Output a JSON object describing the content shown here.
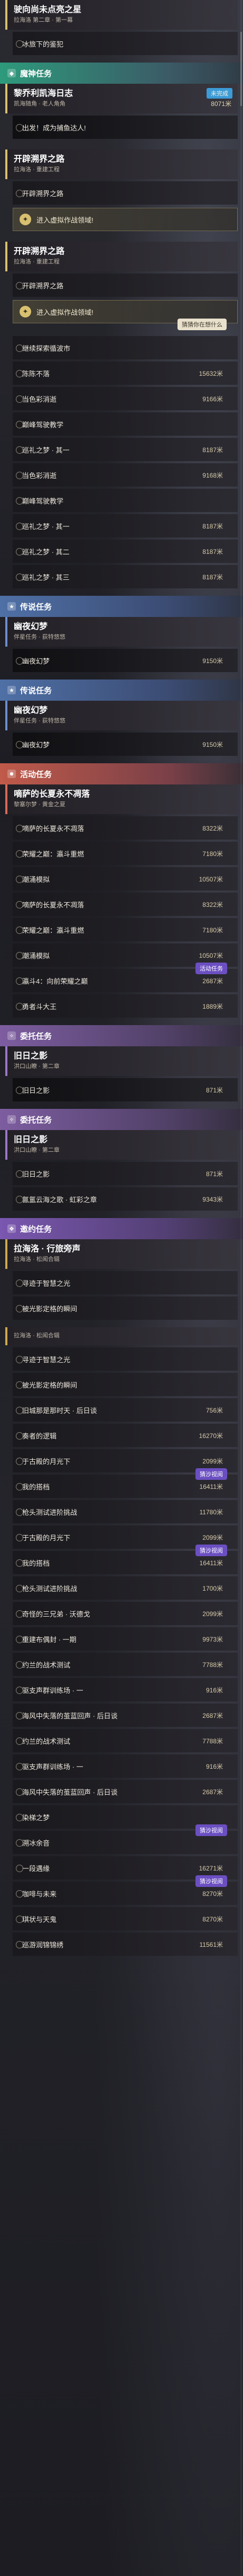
{
  "sections": {
    "main_quest": "魔神任务",
    "side_quest": "传说任务",
    "event_quest": "活动任务",
    "companion_quest": "委托任务",
    "invite_quest": "邀约任务"
  },
  "top": {
    "title": "驶向尚未点亮之星",
    "sub": "拉海洛 第二章 · 第一幕",
    "row1": "冰旅下的鉴犯"
  },
  "main": [
    {
      "title": "黎乔利凯海日志",
      "sub": "凯海随角 · 老人角角",
      "tag": "未完成",
      "points": "8071米",
      "rows": [
        {
          "label": "出发！成为捕鱼达人!",
          "points": ""
        }
      ]
    }
  ],
  "blocks": [
    {
      "title": "开辟溯界之路",
      "sub": "拉海洛 · 重建工程",
      "rows": [
        {
          "label": "开辟溯界之路",
          "points": ""
        }
      ],
      "domain": "进入虚拟作战领域!"
    },
    {
      "title": "开辟溯界之路",
      "sub": "拉海洛 · 重建工程",
      "rows": [
        {
          "label": "开辟溯界之路",
          "points": ""
        }
      ],
      "domain": "进入虚拟作战领域!",
      "badge": "猜猜你在想什么"
    }
  ],
  "list_a": [
    {
      "label": "继续探索循波市",
      "points": ""
    },
    {
      "label": "陈陈不落",
      "points": "15632米"
    },
    {
      "label": "当色彩消逝",
      "points": "9166米"
    },
    {
      "label": "巅峰驾驶教学",
      "points": ""
    },
    {
      "label": "巡礼之梦 · 其一",
      "points": "8187米"
    },
    {
      "label": "当色彩消逝",
      "points": "9168米"
    },
    {
      "label": "巅峰驾驶教学",
      "points": ""
    },
    {
      "label": "巡礼之梦 · 其一",
      "points": "8187米"
    },
    {
      "label": "巡礼之梦 · 其二",
      "points": "8187米"
    },
    {
      "label": "巡礼之梦 · 其三",
      "points": "8187米"
    }
  ],
  "side_a": {
    "title": "幽夜幻梦",
    "sub": "伴星任务 · 荻特悠悠",
    "rows": [
      {
        "label": "幽夜幻梦",
        "points": "9150米"
      }
    ]
  },
  "side_b": {
    "title": "幽夜幻梦",
    "sub": "伴星任务 · 荻特悠悠",
    "rows": [
      {
        "label": "幽夜幻梦",
        "points": "9150米"
      }
    ]
  },
  "event": {
    "title": "嘀萨的长夏永不凋落",
    "sub": "黎塞尔梦 · 黄金之夏",
    "rows": [
      {
        "label": "嘀萨的长夏永不凋落",
        "points": "8322米"
      },
      {
        "label": "荣耀之巅：瀛斗重燃",
        "points": "7180米"
      },
      {
        "label": "潮涌模拟",
        "points": "10507米"
      },
      {
        "label": "嘀萨的长夏永不凋落",
        "points": "8322米"
      },
      {
        "label": "荣耀之巅：瀛斗重燃",
        "points": "7180米"
      },
      {
        "label": "潮涌模拟",
        "points": "10507米"
      },
      {
        "label": "瀛斗4：向前荣耀之巅",
        "points": "2687米",
        "badge": "活动任务"
      },
      {
        "label": "勇者斗大王",
        "points": "1889米"
      }
    ]
  },
  "comp_a": {
    "title": "旧日之影",
    "sub": "洪口山瞭 · 第二章",
    "rows": [
      {
        "label": "旧日之影",
        "points": "871米"
      }
    ]
  },
  "comp_b": {
    "title": "旧日之影",
    "sub": "洪口山瞭 · 第二章",
    "rows": [
      {
        "label": "旧日之影",
        "points": "871米"
      },
      {
        "label": "氤氲云海之歌 · 虹彩之章",
        "points": "9343米"
      }
    ]
  },
  "invite": {
    "title": "拉海洛 · 行旅旁声",
    "sub": "拉海洛 · 松闻合辑",
    "rows": [
      {
        "label": "寻迹于智慧之光",
        "points": ""
      },
      {
        "label": "被光影定格的瞬间",
        "points": ""
      }
    ]
  },
  "invite_b": {
    "sub": "拉海洛 · 松闻合辑",
    "rows": [
      {
        "label": "寻迹于智慧之光",
        "points": ""
      },
      {
        "label": "被光影定格的瞬间",
        "points": ""
      },
      {
        "label": "旧城那是那时天 · 后日谈",
        "points": "756米"
      },
      {
        "label": "奏者的逻辑",
        "points": "16270米"
      },
      {
        "label": "于古殿的月光下",
        "points": "2099米"
      },
      {
        "label": "我的搭档",
        "points": "16411米",
        "badge": "猜沙视阅"
      },
      {
        "label": "枪头测试进阶挑战",
        "points": "11780米"
      },
      {
        "label": "于古殿的月光下",
        "points": "2099米"
      },
      {
        "label": "我的搭档",
        "points": "16411米",
        "badge": "猜沙视阅"
      },
      {
        "label": "枪头测试进阶挑战",
        "points": "1700米"
      },
      {
        "label": "奇怪的三兄弟 · 沃德戈",
        "points": "2099米"
      },
      {
        "label": "重建布偶封 · 一期",
        "points": "9973米"
      },
      {
        "label": "约兰的战术测试",
        "points": "7788米"
      },
      {
        "label": "驱支声群训练场 · 一",
        "points": "916米"
      },
      {
        "label": "海风中失落的茧蓝回声 · 后日谈",
        "points": "2687米"
      },
      {
        "label": "约兰的战术测试",
        "points": "7788米"
      },
      {
        "label": "驱支声群训练场 · 一",
        "points": "916米"
      },
      {
        "label": "海风中失落的茧蓝回声 · 后日谈",
        "points": "2687米"
      },
      {
        "label": "染梯之梦",
        "points": ""
      },
      {
        "label": "溯冰余音",
        "points": "",
        "badge": "猜沙视阅"
      },
      {
        "label": "一段遇缘",
        "points": "16271米"
      },
      {
        "label": "咖啡与未来",
        "points": "8270米",
        "badge": "猜沙视阅"
      },
      {
        "label": "琪状与天鬼",
        "points": "8270米"
      },
      {
        "label": "巡游润锦锦绣",
        "points": "11561米"
      }
    ]
  }
}
